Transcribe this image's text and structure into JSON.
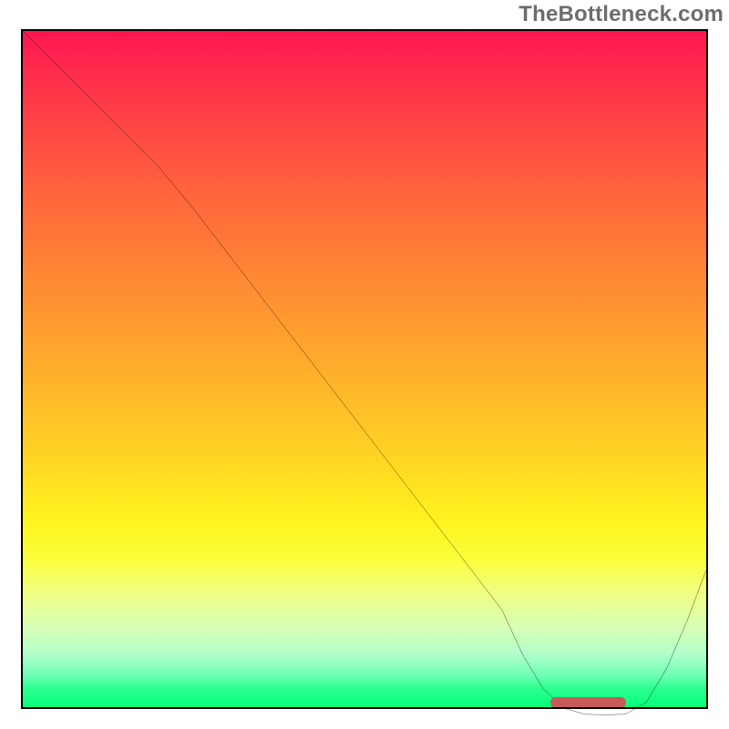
{
  "watermark": "TheBottleneck.com",
  "chart_data": {
    "type": "line",
    "title": "",
    "xlabel": "",
    "ylabel": "",
    "xlim": [
      0,
      100
    ],
    "ylim": [
      0,
      100
    ],
    "grid": false,
    "legend": false,
    "background": "red-yellow-green vertical gradient (bottleneck severity)",
    "series": [
      {
        "name": "bottleneck-curve",
        "x": [
          0,
          5,
          10,
          15,
          20,
          25,
          30,
          35,
          40,
          45,
          50,
          55,
          60,
          65,
          70,
          73,
          76,
          79,
          82,
          85,
          88,
          91,
          94,
          97,
          100
        ],
        "y": [
          100,
          95,
          90,
          85,
          80,
          74,
          67.5,
          61,
          54.5,
          48,
          41.5,
          35,
          28.5,
          22,
          15.5,
          9,
          4,
          1.2,
          0.3,
          0.2,
          0.3,
          2,
          7,
          14,
          22
        ]
      }
    ],
    "annotations": [
      {
        "name": "optimal-range-marker",
        "x_start": 77,
        "x_end": 88,
        "y": 0
      }
    ]
  },
  "marker": {
    "left_pct": 77,
    "width_pct": 11
  }
}
